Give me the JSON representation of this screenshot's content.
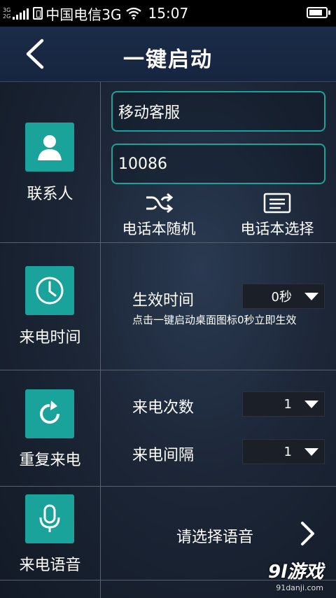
{
  "status_bar": {
    "network_top": "3G",
    "network_bottom": "2G",
    "carrier": "中国电信3G",
    "time": "15:07"
  },
  "header": {
    "title": "一键启动"
  },
  "contact": {
    "label": "联系人",
    "name_value": "移动客服",
    "number_value": "10086",
    "random_label": "电话本随机",
    "select_label": "电话本选择"
  },
  "call_time": {
    "label": "来电时间",
    "effective_label": "生效时间",
    "effective_value": "0秒",
    "hint": "点击一键启动桌面图标0秒立即生效"
  },
  "repeat_call": {
    "label": "重复来电",
    "count_label": "来电次数",
    "count_value": "1",
    "interval_label": "来电间隔",
    "interval_value": "1"
  },
  "voice": {
    "label": "来电语音",
    "select_label": "请选择语音"
  },
  "watermark": {
    "main": "9l游戏",
    "sub": "91danji.com"
  },
  "colors": {
    "accent": "#1aa39a",
    "titlebar": "#172742",
    "divider": "#56606e"
  },
  "icons": {
    "back": "back-arrow-icon",
    "contact": "person-icon",
    "random": "shuffle-icon",
    "select": "list-icon",
    "clock": "clock-icon",
    "repeat": "refresh-icon",
    "mic": "microphone-icon",
    "chevron": "chevron-right-icon"
  }
}
